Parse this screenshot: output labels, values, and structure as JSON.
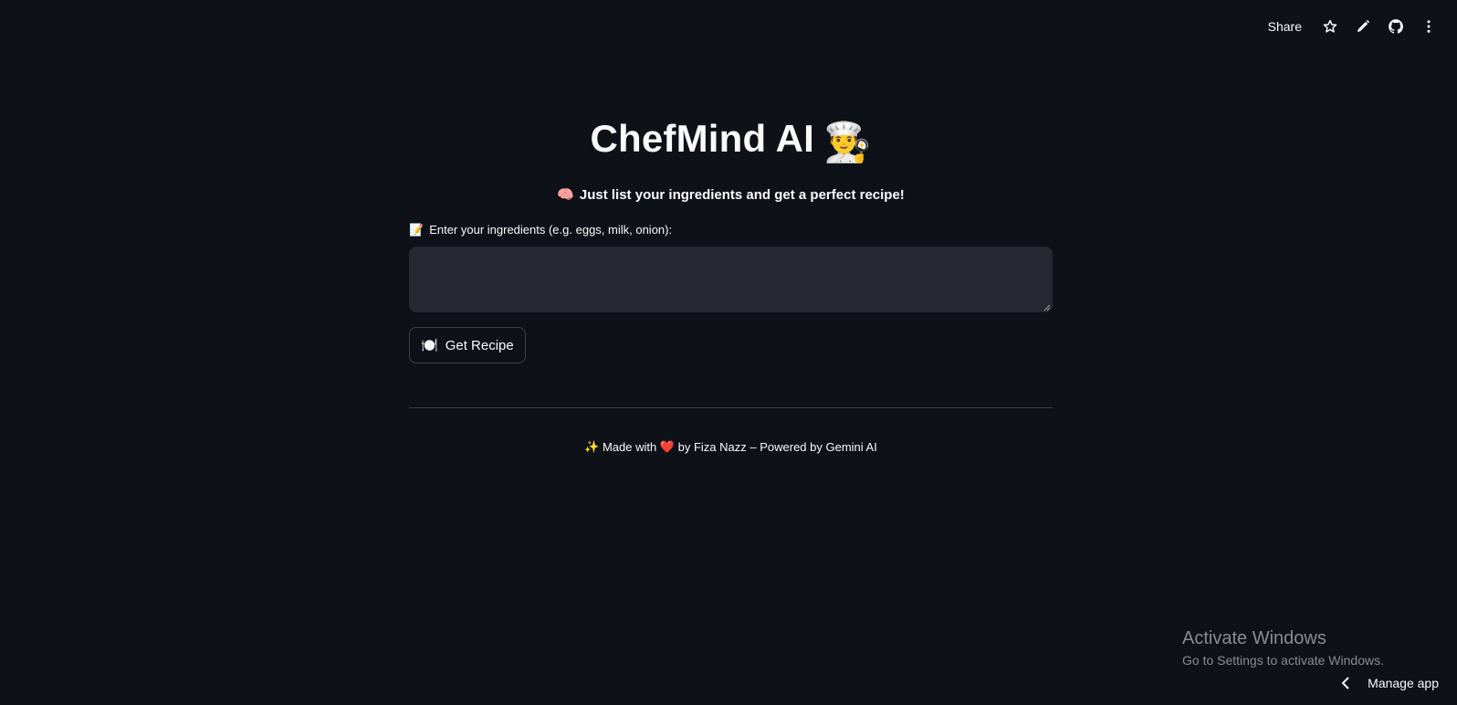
{
  "toolbar": {
    "share_label": "Share",
    "icons": [
      "star-icon",
      "pencil-icon",
      "github-icon",
      "more-vertical-icon"
    ]
  },
  "header": {
    "title": "ChefMind AI",
    "title_emoji": "👨‍🍳",
    "subtitle_emoji": "🧠",
    "subtitle": "Just list your ingredients and get a perfect recipe!"
  },
  "ingredients": {
    "label_emoji": "📝",
    "label": "Enter your ingredients (e.g. eggs, milk, onion):",
    "value": "",
    "placeholder": ""
  },
  "actions": {
    "get_recipe_emoji": "🍽️",
    "get_recipe_label": "Get Recipe"
  },
  "footer": {
    "sparkle": "✨",
    "made_with": "Made with",
    "heart": "❤️",
    "credit": "by Fiza Nazz – Powered by Gemini AI"
  },
  "watermark": {
    "title": "Activate Windows",
    "subtitle": "Go to Settings to activate Windows."
  },
  "manage_app": {
    "label": "Manage app"
  },
  "colors": {
    "background": "#0e1117",
    "input_bg": "#262730",
    "text": "#fafafa",
    "heart": "#e0232c"
  }
}
